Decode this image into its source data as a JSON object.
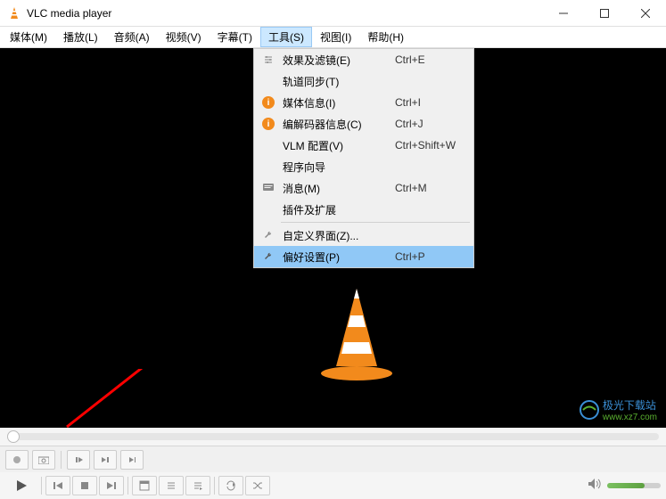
{
  "title": "VLC media player",
  "menubar": [
    "媒体(M)",
    "播放(L)",
    "音频(A)",
    "视频(V)",
    "字幕(T)",
    "工具(S)",
    "视图(I)",
    "帮助(H)"
  ],
  "active_menu_index": 5,
  "dropdown": {
    "items": [
      {
        "icon": "sliders",
        "label": "效果及滤镜(E)",
        "shortcut": "Ctrl+E"
      },
      {
        "icon": "",
        "label": "轨道同步(T)",
        "shortcut": ""
      },
      {
        "icon": "info",
        "label": "媒体信息(I)",
        "shortcut": "Ctrl+I"
      },
      {
        "icon": "info",
        "label": "编解码器信息(C)",
        "shortcut": "Ctrl+J"
      },
      {
        "icon": "",
        "label": "VLM 配置(V)",
        "shortcut": "Ctrl+Shift+W"
      },
      {
        "icon": "",
        "label": "程序向导",
        "shortcut": ""
      },
      {
        "icon": "msg",
        "label": "消息(M)",
        "shortcut": "Ctrl+M"
      },
      {
        "icon": "",
        "label": "插件及扩展",
        "shortcut": ""
      }
    ],
    "separator_after": 7,
    "bottom": [
      {
        "icon": "wrench",
        "label": "自定义界面(Z)...",
        "shortcut": ""
      },
      {
        "icon": "wrench",
        "label": "偏好设置(P)",
        "shortcut": "Ctrl+P",
        "highlighted": true
      }
    ]
  },
  "watermark": "极光下载站",
  "watermark_sub": "www.xz7.com",
  "volume_percent": 70
}
